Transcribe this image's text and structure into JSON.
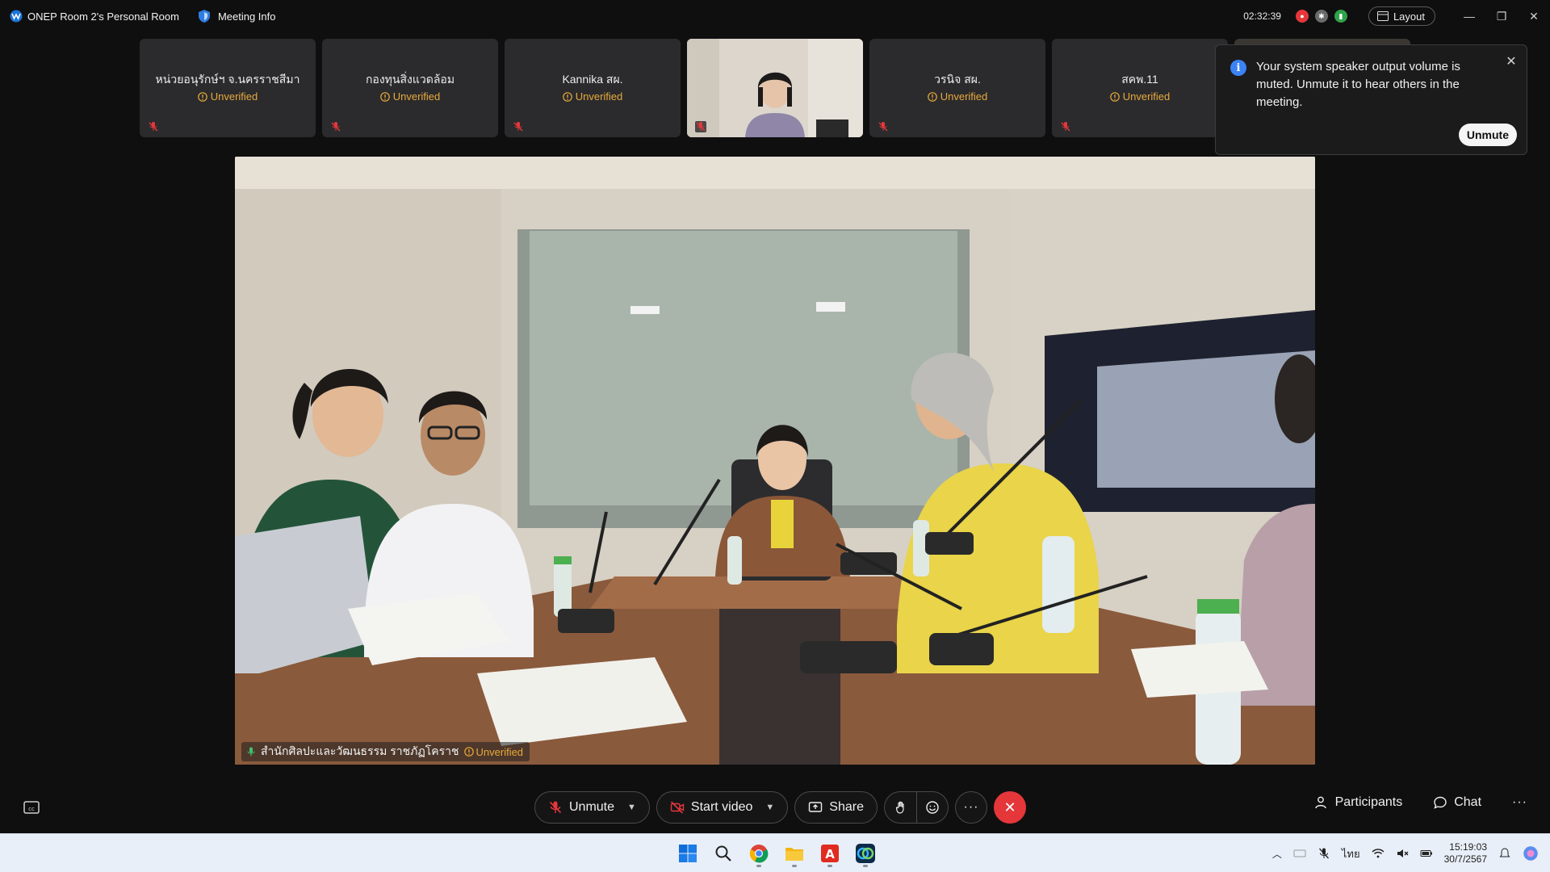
{
  "titlebar": {
    "room_title": "ONEP Room 2's Personal Room",
    "meeting_info": "Meeting Info",
    "timer": "02:32:39",
    "layout_label": "Layout"
  },
  "thumbnails": [
    {
      "name": "หน่วยอนุรักษ์ฯ จ.นครราชสีมา",
      "status": "Unverified"
    },
    {
      "name": "กองทุนสิ่งแวดล้อม",
      "status": "Unverified"
    },
    {
      "name": "Kannika สผ.",
      "status": "Unverified"
    },
    {
      "name": "",
      "status": ""
    },
    {
      "name": "วรนิจ สผ.",
      "status": "Unverified"
    },
    {
      "name": "สคพ.11",
      "status": "Unverified"
    }
  ],
  "toast": {
    "message": "Your system speaker output volume is muted. Unmute it to hear others in the meeting.",
    "button": "Unmute"
  },
  "main_video": {
    "name": "สำนักศิลปะและวัฒนธรรม ราชภัฏโคราช",
    "status": "Unverified"
  },
  "controls": {
    "unmute": "Unmute",
    "start_video": "Start video",
    "share": "Share",
    "participants": "Participants",
    "chat": "Chat"
  },
  "taskbar": {
    "time": "15:19:03",
    "date": "30/7/2567",
    "lang": "ไทย"
  },
  "colors": {
    "unverified": "#e9a93b",
    "end_call": "#e5373a",
    "info_blue": "#3b82f6"
  }
}
